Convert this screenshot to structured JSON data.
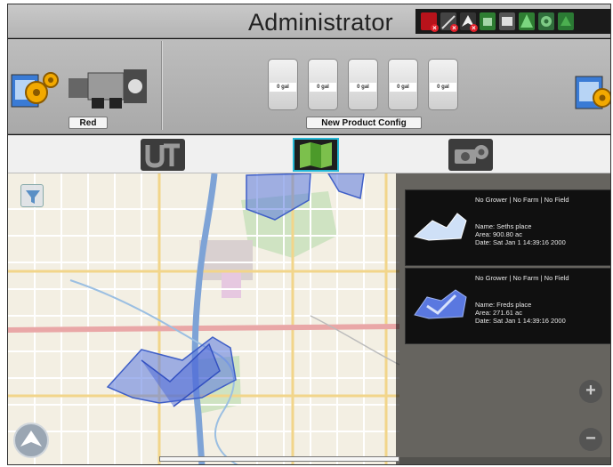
{
  "header": {
    "title": "Administrator",
    "tray_icons": [
      "gps-icon",
      "antenna-icon",
      "navigation-icon",
      "steering-icon",
      "data-icon",
      "tree-icon",
      "settings-icon"
    ]
  },
  "config": {
    "vehicle_label": "Red",
    "product_label": "New Product Config",
    "tanks": [
      "0 gal",
      "0 gal",
      "0 gal",
      "0 gal",
      "0 gal"
    ]
  },
  "tabs": [
    {
      "id": "ut",
      "icon": "universal-terminal-icon",
      "selected": false
    },
    {
      "id": "map",
      "icon": "field-map-icon",
      "selected": true
    },
    {
      "id": "camera",
      "icon": "camera-icon",
      "selected": false
    }
  ],
  "map": {
    "zoom_in": "+",
    "zoom_out": "−",
    "fields": [
      {
        "header": "No Grower | No Farm | No Field",
        "name": "Name: Seths place",
        "area": "Area: 900.80 ac",
        "date": "Date: Sat Jan 1 14:39:16 2000"
      },
      {
        "header": "No Grower | No Farm | No Field",
        "name": "Name: Freds place",
        "area": "Area: 271.61 ac",
        "date": "Date: Sat Jan 1 14:39:16 2000"
      }
    ]
  },
  "colors": {
    "title_bar": "#c4c4c4",
    "field_fill": "#5a78e0",
    "selected_tab_border": "#25b7d5",
    "map_background": "#f3efe3"
  }
}
